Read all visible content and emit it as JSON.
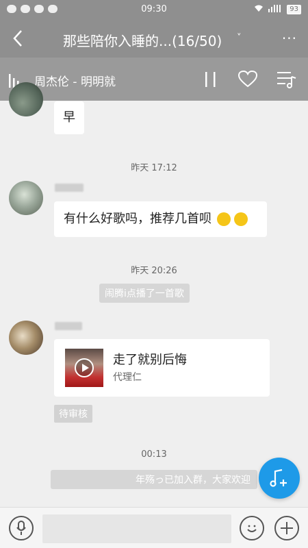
{
  "status_bar": {
    "time": "09:30",
    "battery": "93"
  },
  "header": {
    "title": "那些陪你入睡的...(16/50)",
    "chevron": "˅",
    "more": "···"
  },
  "now_playing": {
    "song": "周杰伦 - 明明就"
  },
  "messages": {
    "msg1_text": "早",
    "time1": "昨天 17:12",
    "msg2_text": "有什么好歌吗，推荐几首呗",
    "time2": "昨天 20:26",
    "system1": "闹腾i点播了一首歌",
    "card_title": "走了就别后悔",
    "card_artist": "代理仁",
    "pending": "待审核",
    "time3": "00:13",
    "system2": "年殇っ已加入群，大家欢迎"
  },
  "colors": {
    "accent": "#1e9ae8",
    "header_bg": "#8f8f8f",
    "chat_bg": "#efefef"
  },
  "icons": [
    "back-arrow-icon",
    "more-icon",
    "bars-icon",
    "pause-icon",
    "heart-icon",
    "playlist-icon",
    "play-icon",
    "music-add-icon",
    "microphone-icon",
    "emoji-icon",
    "plus-icon"
  ]
}
